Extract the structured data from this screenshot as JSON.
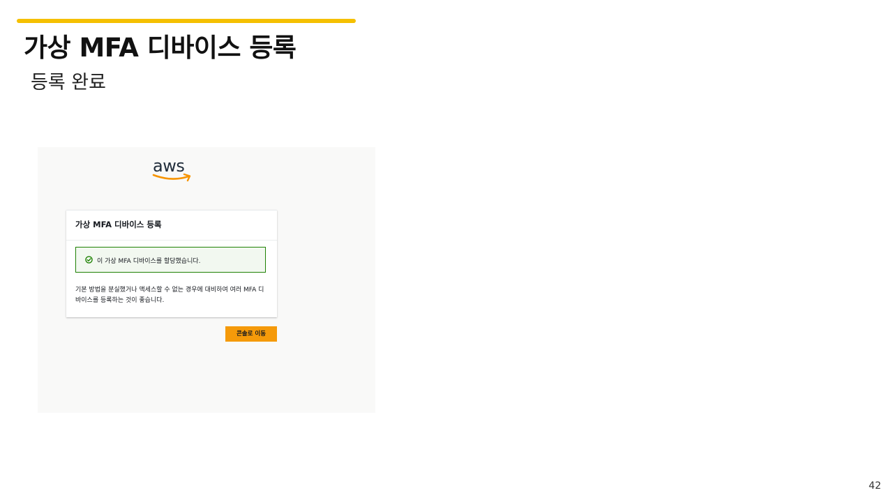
{
  "slide": {
    "title": "가상 MFA 디바이스 등록",
    "subtitle": "등록 완료",
    "page_number": "42",
    "accent_color": "#f5c000"
  },
  "screenshot": {
    "logo": {
      "text": "aws",
      "smile_color": "#f79400"
    },
    "card": {
      "title": "가상 MFA 디바이스 등록",
      "alert": {
        "icon": "check-circle-icon",
        "text": "이 가상 MFA 디바이스를 할당했습니다.",
        "color": "#1d8102"
      },
      "body_line1": "기본 방법을 분실했거나 액세스할 수 없는 경우에 대비하여 여러 MFA 디",
      "body_line2": "바이스를 등록하는 것이 좋습니다."
    },
    "console_button_label": "콘솔로 이동",
    "button_color": "#f59a0a"
  }
}
